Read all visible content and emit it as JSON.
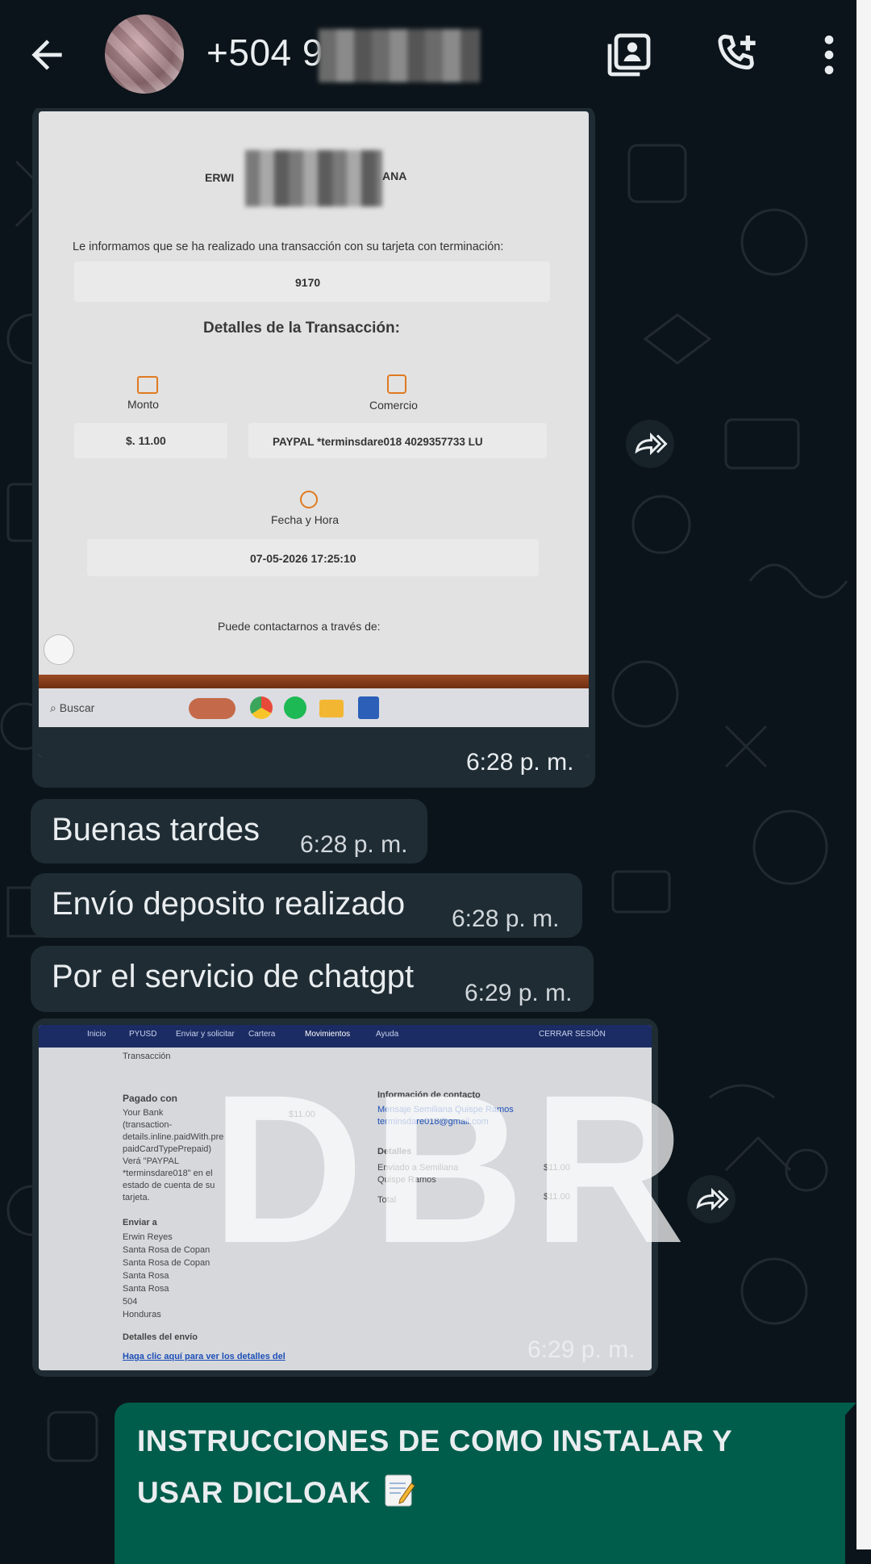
{
  "header": {
    "back_icon": "arrow-left-icon",
    "contact_visible": "+504 9",
    "icons": [
      "contact-card-icon",
      "add-call-icon",
      "more-vertical-icon"
    ]
  },
  "messages": {
    "image1": {
      "time": "6:28 p. m.",
      "email": {
        "name_left": "ERWI",
        "name_right": "ANA",
        "intro": "Le informamos que se ha realizado una transacción con su tarjeta con terminación:",
        "card_end": "9170",
        "details_title": "Detalles de la Transacción:",
        "monto_label": "Monto",
        "comercio_label": "Comercio",
        "monto_value": "$. 11.00",
        "comercio_value": "PAYPAL *terminsdare018 4029357733 LU",
        "fecha_label": "Fecha y Hora",
        "fecha_value": "07-05-2026 17:25:10",
        "contact_text": "Puede contactarnos a través de:",
        "search_label": "Buscar"
      }
    },
    "text1": {
      "text": "Buenas tardes",
      "time": "6:28 p. m."
    },
    "text2": {
      "text": "Envío deposito realizado",
      "time": "6:28 p. m."
    },
    "text3": {
      "text": "Por el servicio de chatgpt",
      "time": "6:29 p. m."
    },
    "image2": {
      "time": "6:29 p. m.",
      "watermark": "DBR",
      "nav": [
        "Inicio",
        "PYUSD",
        "Enviar y solicitar",
        "Cartera",
        "Movimientos",
        "Ayuda"
      ],
      "nav_right": "CERRAR SESIÓN",
      "transaccion": "Transacción",
      "pagado_con": "Pagado con",
      "bank_text": [
        "Your Bank",
        "(transaction-",
        "details.inline.paidWith.pre",
        "paidCardTypePrepaid)",
        "Verá \"PAYPAL",
        "*terminsdare018\" en el",
        "estado de cuenta de su",
        "tarjeta."
      ],
      "amount": "$11.00",
      "enviar_a": "Enviar a",
      "address": [
        "Erwin Reyes",
        "Santa Rosa de Copan",
        "Santa Rosa de Copan",
        "Santa Rosa",
        "Santa Rosa",
        "504",
        "Honduras"
      ],
      "detalles_envio": "Detalles del envío",
      "link": "Haga clic aquí para ver los detalles del",
      "info_contacto": "Información de contacto",
      "mensaje": "Mensaje Semiliana Quispe Ramos",
      "email": "terminsdare018@gmail.com",
      "detalles": "Detalles",
      "enviado_a": [
        "Enviado a Semiliana",
        "Quispe Ramos"
      ],
      "enviado_amount": "$11.00",
      "total": "Total",
      "total_amount": "$11.00"
    },
    "instructions": {
      "line1": "INSTRUCCIONES DE COMO INSTALAR Y",
      "line2": "USAR DICLOAK",
      "icon": "memo-icon"
    }
  },
  "colors": {
    "bg": "#0b141a",
    "bubble": "#1f2c34",
    "outgoing": "#005c4b"
  }
}
